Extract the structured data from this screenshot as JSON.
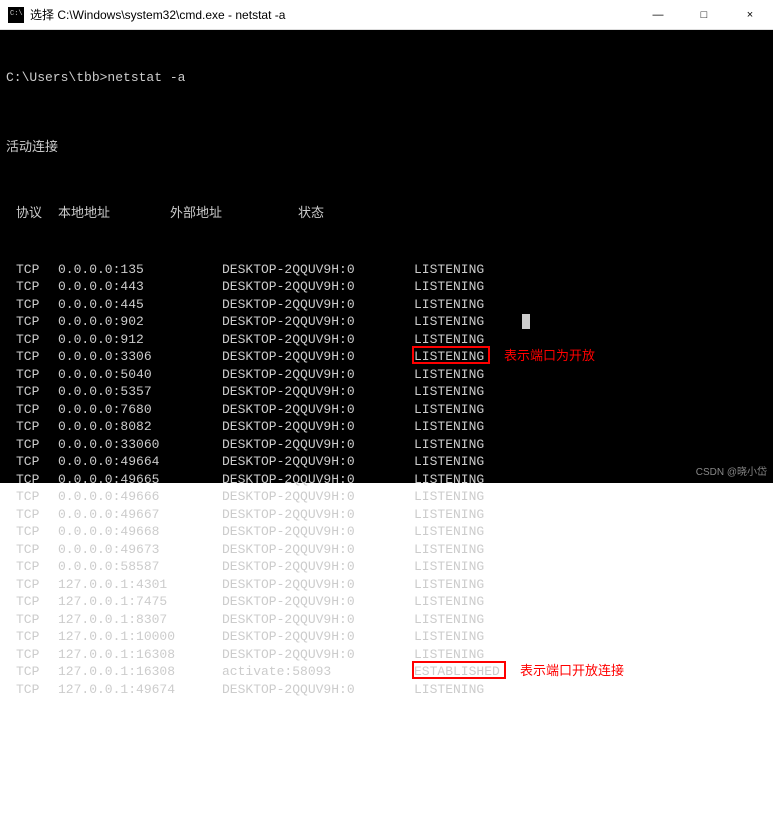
{
  "titlebar": {
    "title": "选择 C:\\Windows\\system32\\cmd.exe - netstat  -a"
  },
  "window_controls": {
    "minimize": "—",
    "maximize": "□",
    "close": "×"
  },
  "prompt": {
    "path": "C:\\Users\\tbb>",
    "command": "netstat -a"
  },
  "section_title": "活动连接",
  "headers": {
    "proto": "协议",
    "local": "本地地址",
    "foreign": "外部地址",
    "state": "状态"
  },
  "rows": [
    {
      "proto": "TCP",
      "local": "0.0.0.0:135",
      "foreign": "DESKTOP-2QQUV9H:0",
      "state": "LISTENING"
    },
    {
      "proto": "TCP",
      "local": "0.0.0.0:443",
      "foreign": "DESKTOP-2QQUV9H:0",
      "state": "LISTENING"
    },
    {
      "proto": "TCP",
      "local": "0.0.0.0:445",
      "foreign": "DESKTOP-2QQUV9H:0",
      "state": "LISTENING"
    },
    {
      "proto": "TCP",
      "local": "0.0.0.0:902",
      "foreign": "DESKTOP-2QQUV9H:0",
      "state": "LISTENING",
      "cursor": true
    },
    {
      "proto": "TCP",
      "local": "0.0.0.0:912",
      "foreign": "DESKTOP-2QQUV9H:0",
      "state": "LISTENING"
    },
    {
      "proto": "TCP",
      "local": "0.0.0.0:3306",
      "foreign": "DESKTOP-2QQUV9H:0",
      "state": "LISTENING",
      "box": 1
    },
    {
      "proto": "TCP",
      "local": "0.0.0.0:5040",
      "foreign": "DESKTOP-2QQUV9H:0",
      "state": "LISTENING"
    },
    {
      "proto": "TCP",
      "local": "0.0.0.0:5357",
      "foreign": "DESKTOP-2QQUV9H:0",
      "state": "LISTENING"
    },
    {
      "proto": "TCP",
      "local": "0.0.0.0:7680",
      "foreign": "DESKTOP-2QQUV9H:0",
      "state": "LISTENING"
    },
    {
      "proto": "TCP",
      "local": "0.0.0.0:8082",
      "foreign": "DESKTOP-2QQUV9H:0",
      "state": "LISTENING"
    },
    {
      "proto": "TCP",
      "local": "0.0.0.0:33060",
      "foreign": "DESKTOP-2QQUV9H:0",
      "state": "LISTENING"
    },
    {
      "proto": "TCP",
      "local": "0.0.0.0:49664",
      "foreign": "DESKTOP-2QQUV9H:0",
      "state": "LISTENING"
    },
    {
      "proto": "TCP",
      "local": "0.0.0.0:49665",
      "foreign": "DESKTOP-2QQUV9H:0",
      "state": "LISTENING"
    },
    {
      "proto": "TCP",
      "local": "0.0.0.0:49666",
      "foreign": "DESKTOP-2QQUV9H:0",
      "state": "LISTENING"
    },
    {
      "proto": "TCP",
      "local": "0.0.0.0:49667",
      "foreign": "DESKTOP-2QQUV9H:0",
      "state": "LISTENING"
    },
    {
      "proto": "TCP",
      "local": "0.0.0.0:49668",
      "foreign": "DESKTOP-2QQUV9H:0",
      "state": "LISTENING"
    },
    {
      "proto": "TCP",
      "local": "0.0.0.0:49673",
      "foreign": "DESKTOP-2QQUV9H:0",
      "state": "LISTENING"
    },
    {
      "proto": "TCP",
      "local": "0.0.0.0:58587",
      "foreign": "DESKTOP-2QQUV9H:0",
      "state": "LISTENING"
    },
    {
      "proto": "TCP",
      "local": "127.0.0.1:4301",
      "foreign": "DESKTOP-2QQUV9H:0",
      "state": "LISTENING"
    },
    {
      "proto": "TCP",
      "local": "127.0.0.1:7475",
      "foreign": "DESKTOP-2QQUV9H:0",
      "state": "LISTENING"
    },
    {
      "proto": "TCP",
      "local": "127.0.0.1:8307",
      "foreign": "DESKTOP-2QQUV9H:0",
      "state": "LISTENING"
    },
    {
      "proto": "TCP",
      "local": "127.0.0.1:10000",
      "foreign": "DESKTOP-2QQUV9H:0",
      "state": "LISTENING"
    },
    {
      "proto": "TCP",
      "local": "127.0.0.1:16308",
      "foreign": "DESKTOP-2QQUV9H:0",
      "state": "LISTENING"
    },
    {
      "proto": "TCP",
      "local": "127.0.0.1:16308",
      "foreign": "activate:58093",
      "state": "ESTABLISHED",
      "box": 2
    },
    {
      "proto": "TCP",
      "local": "127.0.0.1:49674",
      "foreign": "DESKTOP-2QQUV9H:0",
      "state": "LISTENING"
    }
  ],
  "annotations": {
    "label1": "表示端口为开放",
    "label2": "表示端口开放连接"
  },
  "watermark": "CSDN @晓小岱"
}
